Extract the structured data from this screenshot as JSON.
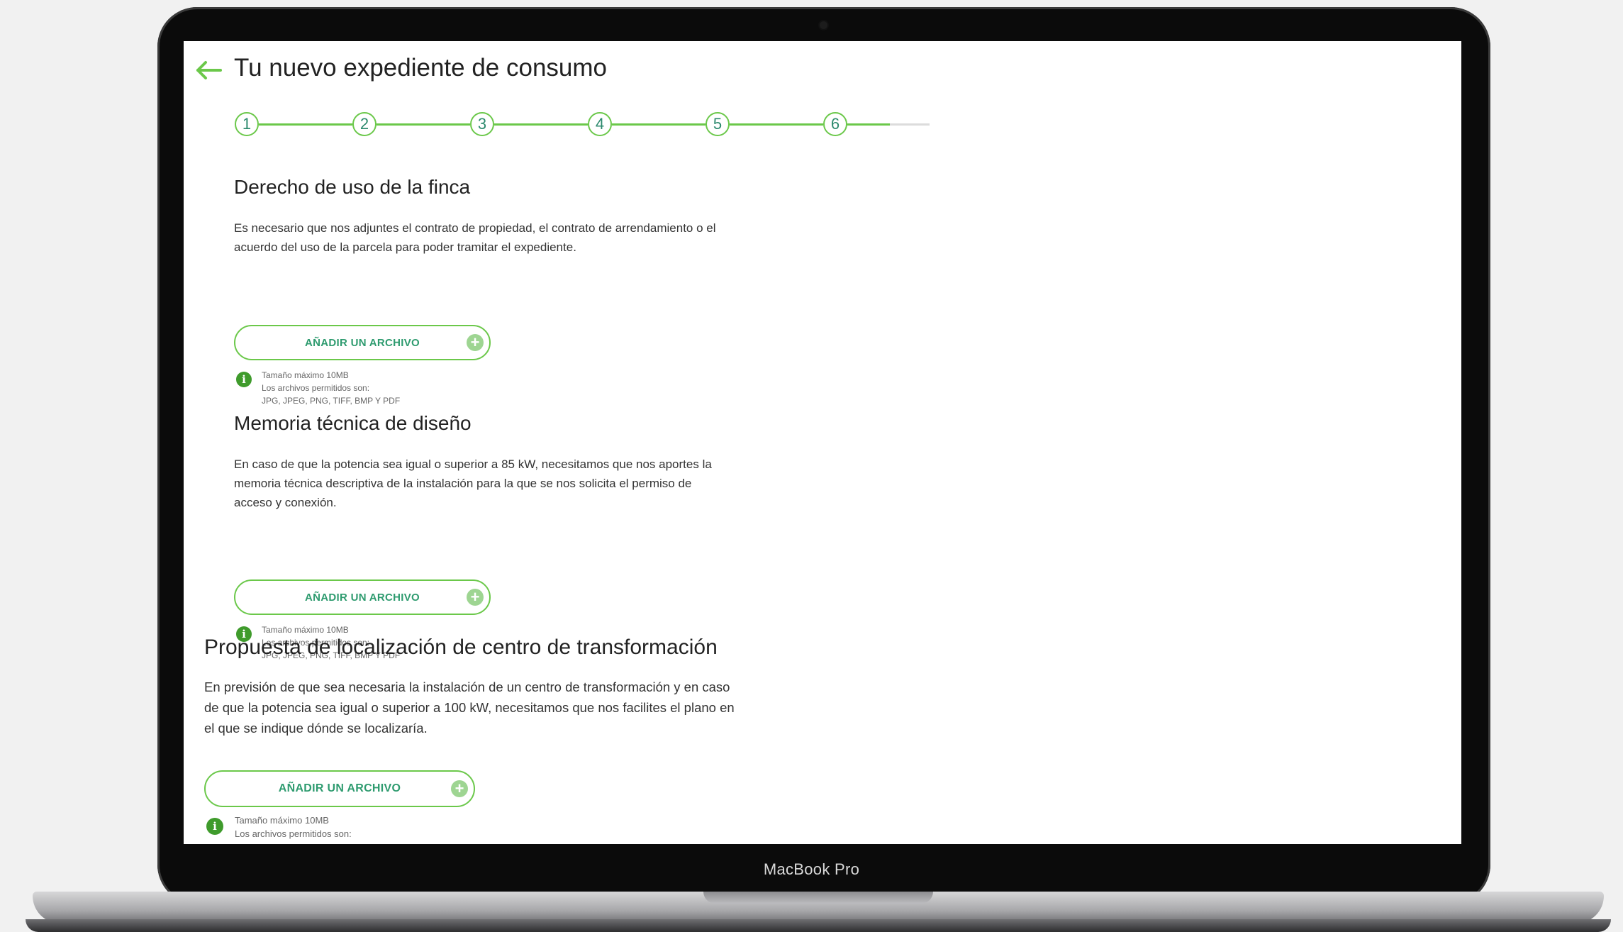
{
  "header": {
    "title": "Tu nuevo expediente de consumo"
  },
  "stepper": {
    "steps": [
      "1",
      "2",
      "3",
      "4",
      "5",
      "6"
    ]
  },
  "sections": [
    {
      "title": "Derecho de uso de la finca",
      "text_lines": [
        "Es necesario que nos adjuntes el contrato de propiedad, el contrato de arrendamiento o el",
        "acuerdo del uso de la parcela para poder tramitar el expediente."
      ],
      "button_label": "AÑADIR UN ARCHIVO",
      "hint_lines": [
        "Tamaño máximo 10MB",
        "Los archivos permitidos son:",
        "JPG, JPEG, PNG, TIFF, BMP Y PDF"
      ]
    },
    {
      "title": "Memoria técnica de diseño",
      "text_lines": [
        "En caso de que la potencia sea igual o superior a 85 kW, necesitamos que nos aportes la",
        "memoria técnica descriptiva de la instalación para la que se nos solicita el permiso de",
        "acceso y conexión."
      ],
      "button_label": "AÑADIR UN ARCHIVO",
      "hint_lines": [
        "Tamaño máximo 10MB",
        "Los archivos permitidos son:",
        "JPG, JPEG, PNG, TIFF, BMP Y PDF"
      ]
    },
    {
      "title": "Propuesta de localización de centro de transformación",
      "text_lines": [
        "En previsión de que sea necesaria la instalación de un centro de transformación y en caso",
        "de que la potencia sea igual o superior a 100 kW, necesitamos que nos facilites el plano en",
        "el que se indique dónde se localizaría."
      ],
      "button_label": "AÑADIR UN ARCHIVO",
      "hint_lines": [
        "Tamaño máximo 10MB",
        "Los archivos permitidos son:"
      ]
    }
  ],
  "device": {
    "label": "MacBook Pro"
  },
  "colors": {
    "accent_green": "#6bc84a",
    "button_text": "#2e9b6f",
    "info_green": "#3f9b2c"
  }
}
